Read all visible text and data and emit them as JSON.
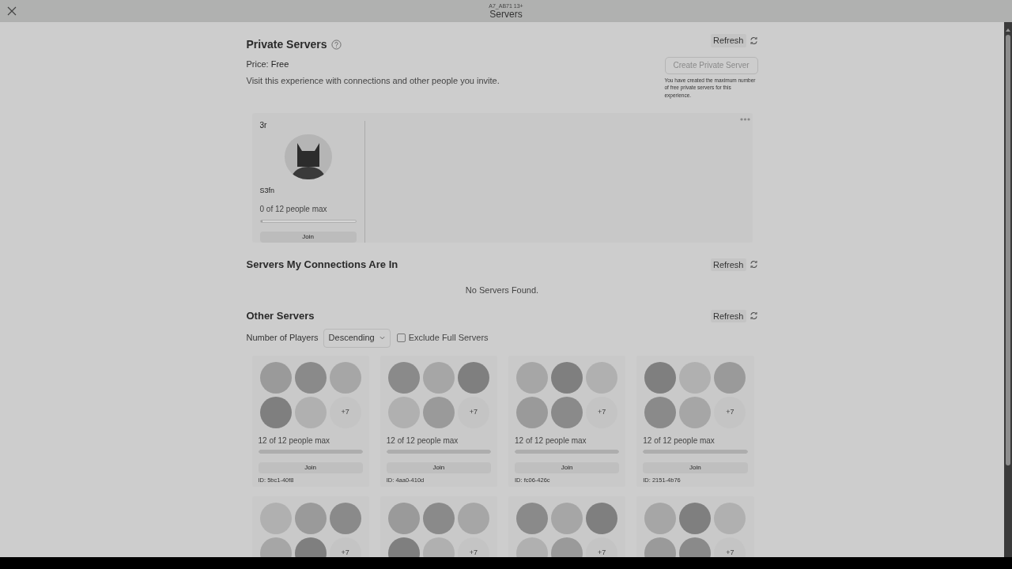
{
  "header": {
    "subtitle": "A7_AB71 13+",
    "title": "Servers"
  },
  "private_servers": {
    "title": "Private Servers",
    "refresh": "Refresh",
    "price_label": "Price:",
    "price": "Free",
    "description": "Visit this experience with connections and other people you invite.",
    "create_button": {
      "label": "Create Private Server",
      "disabled": true
    },
    "create_note": "You have created the maximum number of free private servers for this experience.",
    "servers": [
      {
        "name": "3r",
        "owner": "S3fn",
        "players": "0 of 12 people max",
        "level": 0.02,
        "join": "Join"
      }
    ]
  },
  "connections_servers": {
    "title": "Servers My Connections Are In",
    "refresh": "Refresh",
    "empty": "No Servers Found."
  },
  "other_servers": {
    "title": "Other Servers",
    "refresh": "Refresh",
    "sort_label": "Number of Players",
    "sort_value": "Descending",
    "exclude_full": {
      "label": "Exclude Full Servers",
      "checked": false
    },
    "servers": [
      {
        "more": "+7",
        "players": "12 of 12 people max",
        "level": 1,
        "join": "Join",
        "id": "ID: 5bc1-40f8"
      },
      {
        "more": "+7",
        "players": "12 of 12 people max",
        "level": 1,
        "join": "Join",
        "id": "ID: 4aa0-410d"
      },
      {
        "more": "+7",
        "players": "12 of 12 people max",
        "level": 1,
        "join": "Join",
        "id": "ID: fc06-426c"
      },
      {
        "more": "+7",
        "players": "12 of 12 people max",
        "level": 1,
        "join": "Join",
        "id": "ID: 2151-4b76"
      },
      {
        "more": "+7"
      },
      {
        "more": "+7"
      },
      {
        "more": "+7"
      },
      {
        "more": "+7"
      }
    ]
  }
}
